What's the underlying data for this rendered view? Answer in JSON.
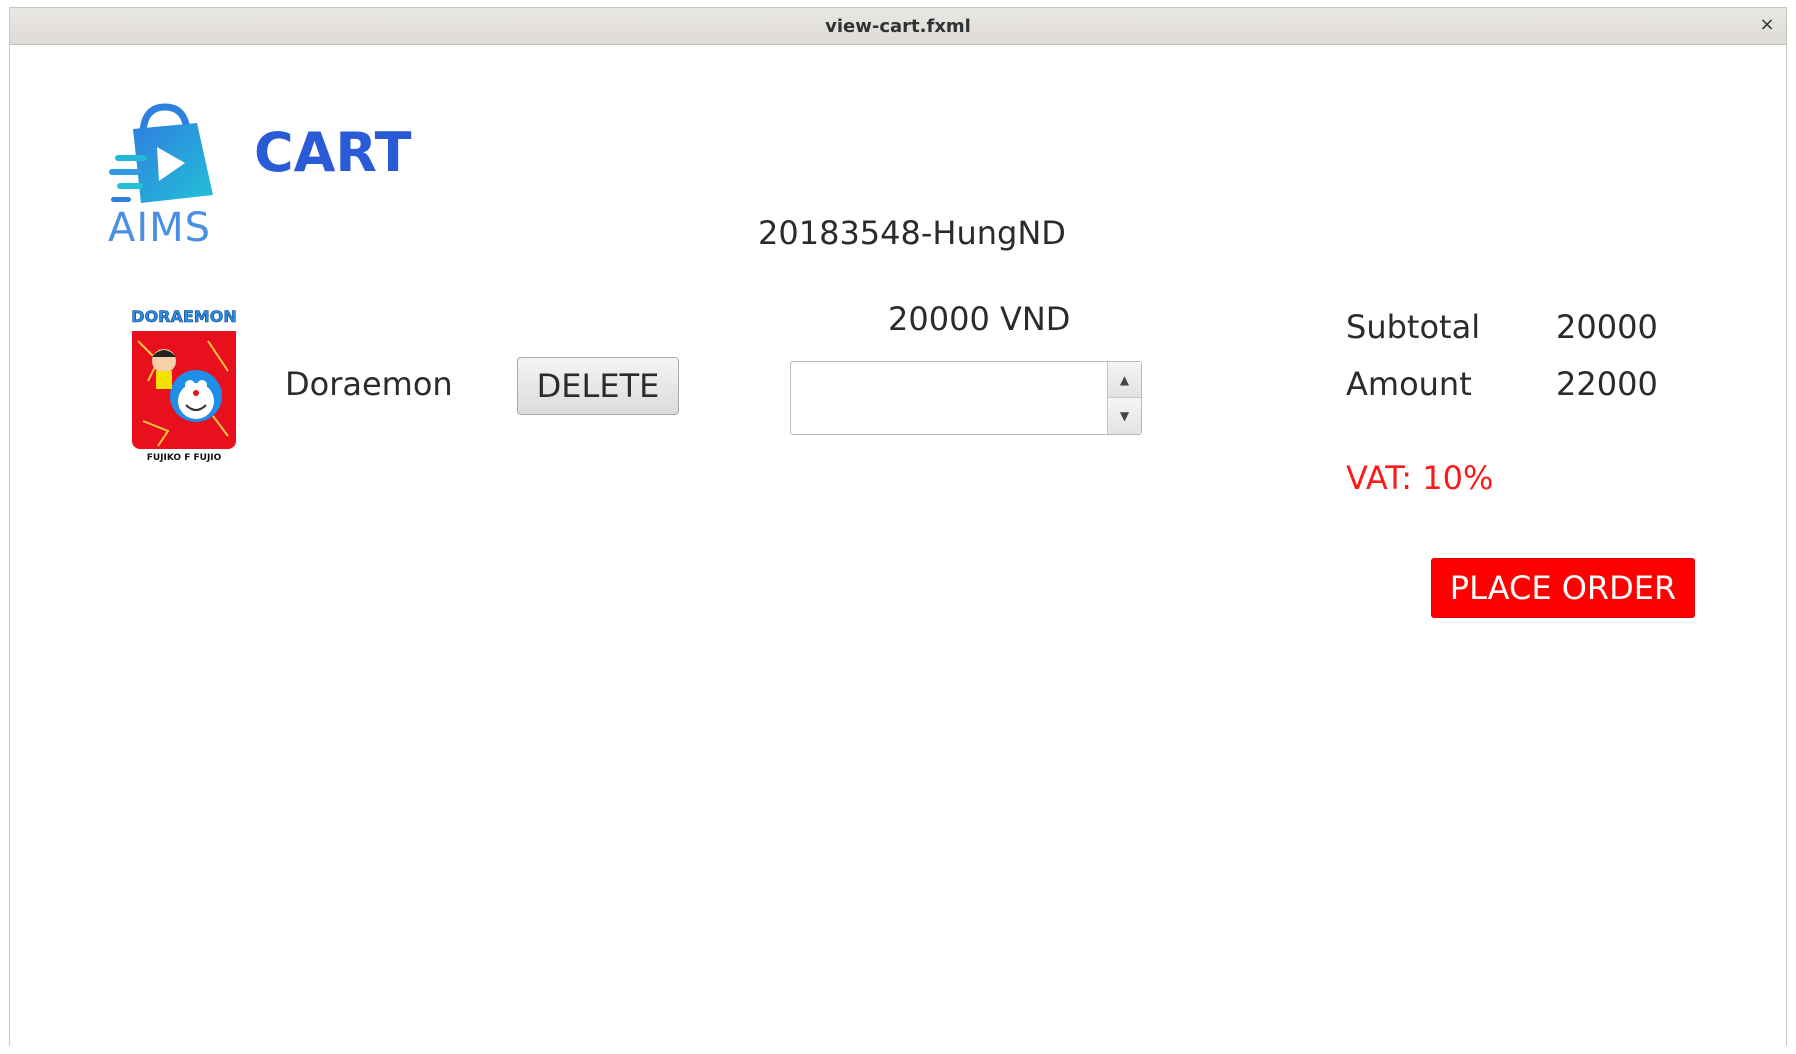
{
  "window": {
    "title": "view-cart.fxml",
    "close_glyph": "×"
  },
  "header": {
    "logo_text": "AIMS",
    "page_title": "CART",
    "user_label": "20183548-HungND"
  },
  "cart_item": {
    "title": "Doraemon",
    "cover_title": "DORAEMON",
    "cover_author": "FUJIKO F FUJIO",
    "delete_label": "DELETE",
    "price": "20000 VND",
    "quantity_value": ""
  },
  "summary": {
    "subtotal_label": "Subtotal",
    "subtotal_value": "20000",
    "amount_label": "Amount",
    "amount_value": "22000",
    "vat_label": "VAT: 10%"
  },
  "actions": {
    "place_order_label": "PLACE ORDER"
  },
  "colors": {
    "accent_blue": "#2a5bd7",
    "logo_blue": "#4a90e2",
    "danger_red": "#ff0000"
  }
}
